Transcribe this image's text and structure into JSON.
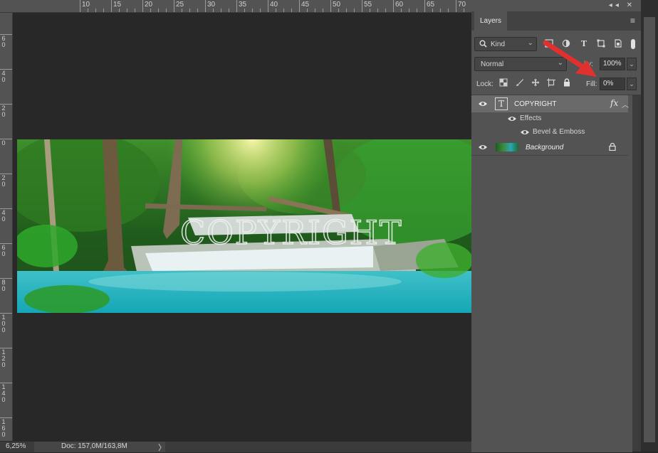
{
  "ruler": {
    "top_labels": [
      "10",
      "15",
      "20",
      "25",
      "30",
      "35",
      "40",
      "45",
      "50",
      "55",
      "60",
      "65",
      "70"
    ],
    "left_labels": [
      "6\n0",
      "4\n0",
      "2\n0",
      "0",
      "2\n0",
      "4\n0",
      "6\n0",
      "8\n0",
      "1\n0\n0",
      "1\n2\n0",
      "1\n4\n0",
      "1\n6\n0"
    ]
  },
  "canvas": {
    "watermark_text": "COPYRIGHT",
    "background_color": "#282828"
  },
  "status_bar": {
    "zoom": "6,25%",
    "doc_info": "Doc: 157,0M/163,8M",
    "arrow_glyph": "〉"
  },
  "panel": {
    "tab_title": "Layers",
    "top_icons": "◂◂ ✕",
    "menu_icon": "≡",
    "filter": {
      "kind_label": "Kind",
      "icons": [
        "image-filter-icon",
        "adjustment-filter-icon",
        "type-filter-icon",
        "shape-filter-icon",
        "smart-object-filter-icon"
      ]
    },
    "blend_mode": "Normal",
    "opacity_label": "Opacity:",
    "opacity_label_visible": "ity:",
    "opacity_value": "100%",
    "lock_label": "Lock:",
    "fill_label": "Fill:",
    "fill_value": "0%",
    "chevron": "⌄",
    "layers": [
      {
        "name": "COPYRIGHT",
        "type_glyph": "T",
        "fx": "fx",
        "effects_label": "Effects",
        "effect": "Bevel & Emboss",
        "selected": true
      },
      {
        "name": "Background",
        "locked": true
      }
    ]
  },
  "colors": {
    "panel_bg": "#535353",
    "selected_row": "#6a6a6a",
    "arrow": "#e2302f",
    "text": "#d6d6d6"
  }
}
